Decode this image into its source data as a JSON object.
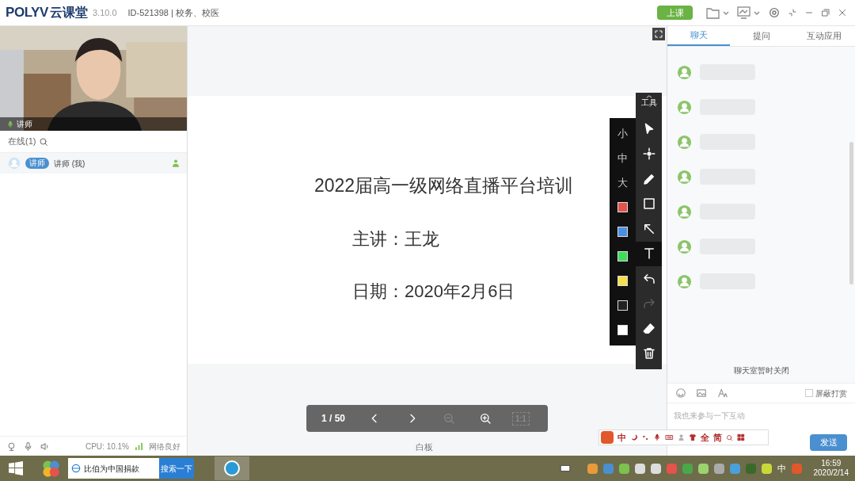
{
  "app": {
    "logo": "POLYV",
    "brand": "云课堂",
    "version": "3.10.0",
    "room": "ID-521398 | 校务、校医"
  },
  "start_button": "上课",
  "video": {
    "label": "讲师"
  },
  "online": {
    "label": "在线(1)"
  },
  "members": [
    {
      "role": "讲师",
      "name": "讲师 (我)"
    }
  ],
  "status": {
    "cpu": "CPU: 10.1%",
    "network": "网络良好"
  },
  "slide": {
    "title": "2022届高一级网络直播平台培训",
    "lines": [
      "主讲：王龙",
      "日期：2020年2月6日"
    ]
  },
  "pager": {
    "page": "1 / 50",
    "fit": "1:1",
    "zoom_out_disabled": true
  },
  "board_label": "白板",
  "tools": {
    "header": "工具",
    "items": [
      {
        "kind": "pointer",
        "selected": false,
        "disabled": false
      },
      {
        "kind": "laser",
        "selected": false,
        "disabled": false
      },
      {
        "kind": "pen",
        "selected": false,
        "disabled": false
      },
      {
        "kind": "rect",
        "selected": false,
        "disabled": false
      },
      {
        "kind": "arrow",
        "selected": false,
        "disabled": false
      },
      {
        "kind": "text",
        "selected": true,
        "disabled": false
      },
      {
        "kind": "undo",
        "selected": false,
        "disabled": false
      },
      {
        "kind": "redo",
        "selected": false,
        "disabled": true
      },
      {
        "kind": "eraser",
        "selected": false,
        "disabled": false
      },
      {
        "kind": "trash",
        "selected": false,
        "disabled": false
      }
    ]
  },
  "sizes": [
    "小",
    "中",
    "大"
  ],
  "colors": [
    {
      "color": "#e5534b"
    },
    {
      "color": "#4a90e2"
    },
    {
      "color": "#3ddc5a"
    },
    {
      "color": "#f5e04a"
    },
    {
      "color": "#222222"
    },
    {
      "color": "#ffffff"
    }
  ],
  "chat": {
    "tabs": [
      {
        "label": "聊天",
        "selected": true
      },
      {
        "label": "提问",
        "selected": false
      },
      {
        "label": "互动应用",
        "selected": false
      }
    ],
    "messages": [
      {
        "kind": "blurred"
      },
      {
        "kind": "blurred"
      },
      {
        "kind": "blurred"
      },
      {
        "kind": "blurred"
      },
      {
        "kind": "blurred"
      },
      {
        "kind": "blurred"
      },
      {
        "kind": "blurred"
      }
    ],
    "closed_notice": "聊天室暂时关闭",
    "block_reward": {
      "label": "屏蔽打赏",
      "checked": false
    },
    "placeholder": "我也来参与一下互动",
    "send": "发送"
  },
  "ime_bar": [
    "中",
    "全",
    "简"
  ],
  "taskbar": {
    "search_value": "比伯为中国捐款",
    "search_button": "搜索一下",
    "lang": "中",
    "time": "16:59",
    "date": "2020/2/14"
  }
}
